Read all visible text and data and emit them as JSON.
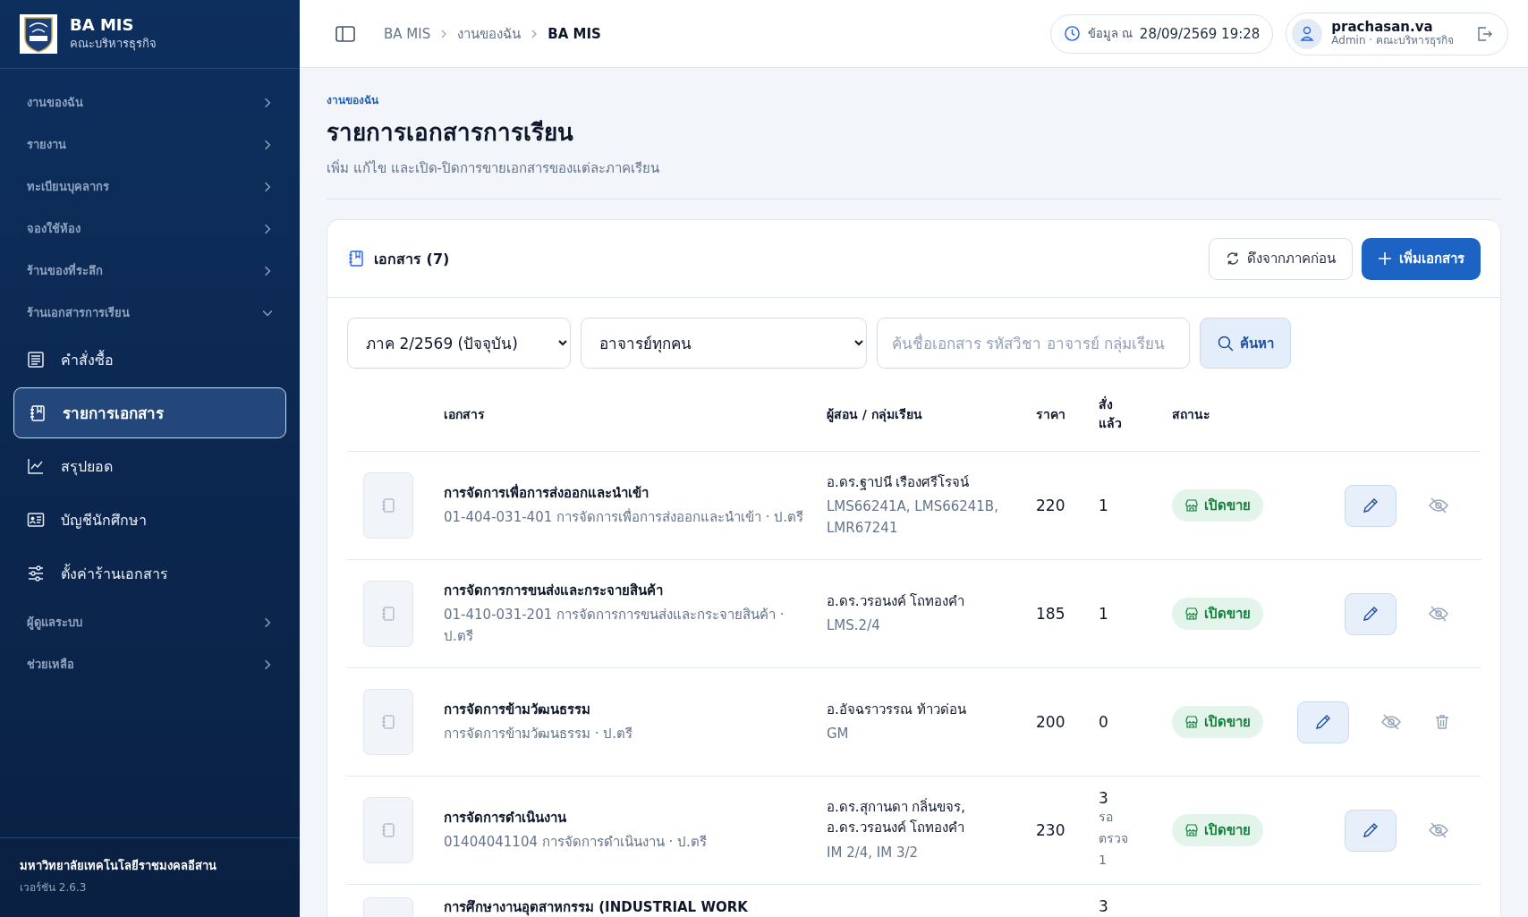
{
  "sidebar": {
    "brand": {
      "title": "BA MIS",
      "subtitle": "คณะบริหารธุรกิจ"
    },
    "items": [
      {
        "label": "งานของฉัน",
        "expanded": false
      },
      {
        "label": "รายงาน",
        "expanded": false
      },
      {
        "label": "ทะเบียนบุคลากร",
        "expanded": false
      },
      {
        "label": "จองใช้ห้อง",
        "expanded": false
      },
      {
        "label": "ร้านของที่ระลึก",
        "expanded": false
      },
      {
        "label": "ร้านเอกสารการเรียน",
        "expanded": true,
        "children": [
          {
            "label": "คำสั่งซื้อ",
            "selected": false
          },
          {
            "label": "รายการเอกสาร",
            "selected": true
          },
          {
            "label": "สรุปยอด",
            "selected": false
          },
          {
            "label": "บัญชีนักศึกษา",
            "selected": false
          },
          {
            "label": "ตั้งค่าร้านเอกสาร",
            "selected": false
          }
        ]
      },
      {
        "label": "ผู้ดูแลระบบ",
        "expanded": false
      },
      {
        "label": "ช่วยเหลือ",
        "expanded": false
      }
    ],
    "footer": {
      "org": "มหาวิทยาลัยเทคโนโลยีราชมงคลอีสาน",
      "version": "เวอร์ชัน 2.6.3"
    }
  },
  "header": {
    "breadcrumbs": [
      "BA MIS",
      "งานของฉัน",
      "BA MIS"
    ],
    "data_label": "ข้อมูล ณ",
    "data_time": "28/09/2569 19:28",
    "user": {
      "name": "prachasan.va",
      "role": "Admin · คณะบริหารธุรกิจ"
    }
  },
  "page": {
    "eyebrow": "งานของฉัน",
    "title": "รายการเอกสารการเรียน",
    "subtitle": "เพิ่ม แก้ไข และเปิด-ปิดการขายเอกสารของแต่ละภาคเรียน"
  },
  "card": {
    "title": "เอกสาร (7)",
    "buttons": [
      {
        "label": "ดึงจากภาคก่อน",
        "kind": "secondary"
      },
      {
        "label": "เพิ่มเอกสาร",
        "kind": "primary"
      }
    ],
    "filters": {
      "term": "ภาค 2/2569 (ปัจจุบัน)",
      "teacher": "อาจารย์ทุกคน",
      "search_placeholder": "ค้นชื่อเอกสาร รหัสวิชา อาจารย์ กลุ่มเรียน",
      "search_button": "ค้นหา"
    },
    "columns": [
      "เอกสาร",
      "ผู้สอน / กลุ่มเรียน",
      "ราคา",
      "สั่ง แล้ว",
      "สถานะ"
    ],
    "rows": [
      {
        "title": "การจัดการเพื่อการส่งออกและนำเข้า",
        "detail": "01-404-031-401 การจัดการเพื่อการส่งออกและนำเข้า · ป.ตรี",
        "teacher": "อ.ดร.ฐาปนี เรืองศรีโรจน์",
        "groups": "LMS66241A, LMS66241B, LMR67241",
        "price": "220",
        "ordered": "1",
        "status": {
          "label": "เปิดขาย",
          "kind": "open"
        },
        "actions": [
          {
            "kind": "edit"
          },
          {
            "kind": "hide"
          }
        ]
      },
      {
        "title": "การจัดการการขนส่งและกระจายสินค้า",
        "detail": "01-410-031-201 การจัดการการขนส่งและกระจายสินค้า · ป.ตรี",
        "teacher": "อ.ดร.วรอนงค์ โถทองคำ",
        "groups": "LMS.2/4",
        "price": "185",
        "ordered": "1",
        "status": {
          "label": "เปิดขาย",
          "kind": "open"
        },
        "actions": [
          {
            "kind": "edit"
          },
          {
            "kind": "hide"
          }
        ]
      },
      {
        "title": "การจัดการข้ามวัฒนธรรม",
        "detail": "การจัดการข้ามวัฒนธรรม · ป.ตรี",
        "teacher": "อ.อัจฉราวรรณ ท้าวด่อน",
        "groups": "GM",
        "price": "200",
        "ordered": "0",
        "status": {
          "label": "เปิดขาย",
          "kind": "open"
        },
        "actions": [
          {
            "kind": "edit"
          },
          {
            "kind": "hide"
          },
          {
            "kind": "delete"
          }
        ]
      },
      {
        "title": "การจัดการดำเนินงาน",
        "detail": "01404041104 การจัดการดำเนินงาน · ป.ตรี",
        "teacher": "อ.ดร.สุกานดา กลิ่นขจร,",
        "teacher_2": "อ.ดร.วรอนงค์ โถทองคำ",
        "groups": "IM 2/4, IM 3/2",
        "price": "230",
        "ordered": "3",
        "pending": "รอ ตรวจ 1",
        "status": {
          "label": "เปิดขาย",
          "kind": "open"
        },
        "actions": [
          {
            "kind": "edit"
          },
          {
            "kind": "hide"
          }
        ]
      },
      {
        "title": "การศึกษางานอุตสาหกรรม (INDUSTRIAL WORK",
        "ordered": "3"
      }
    ]
  }
}
